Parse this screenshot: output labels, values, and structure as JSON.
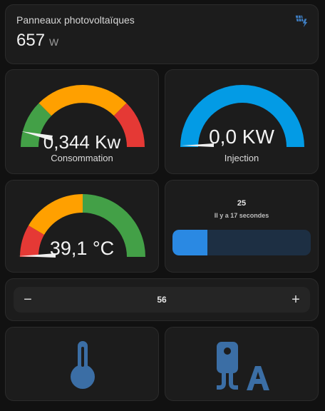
{
  "solar": {
    "title": "Panneaux photovoltaïques",
    "value": "657",
    "unit": "W",
    "icon": "solar-panel-icon"
  },
  "consumption_gauge": {
    "value_text": "0,344 Kw",
    "label": "Consommation",
    "value": 0.344,
    "fraction": 0.08,
    "segment_colors": [
      "#43a047",
      "#ffa000",
      "#e53935"
    ]
  },
  "injection_gauge": {
    "value_text": "0,0 KW",
    "label": "Injection",
    "value": 0.0,
    "fraction": 0.0,
    "color": "#039be5"
  },
  "temperature_gauge": {
    "value_text": "39,1 °C",
    "value": 39.1,
    "fraction": 0.0,
    "segment_colors": [
      "#e53935",
      "#ffa000",
      "#43a047"
    ]
  },
  "sensor_bar": {
    "value": "25",
    "updated": "Il y a 17 secondes",
    "fill_fraction": 0.25,
    "fill_color": "#2a89e3",
    "track_color": "#1d2f43"
  },
  "stepper": {
    "minus": "−",
    "value": "56",
    "plus": "+"
  },
  "buttons": {
    "thermometer_icon": "thermometer-icon",
    "water_heater_icon": "water-heater-auto-icon",
    "icon_color": "#3b6ea5"
  }
}
